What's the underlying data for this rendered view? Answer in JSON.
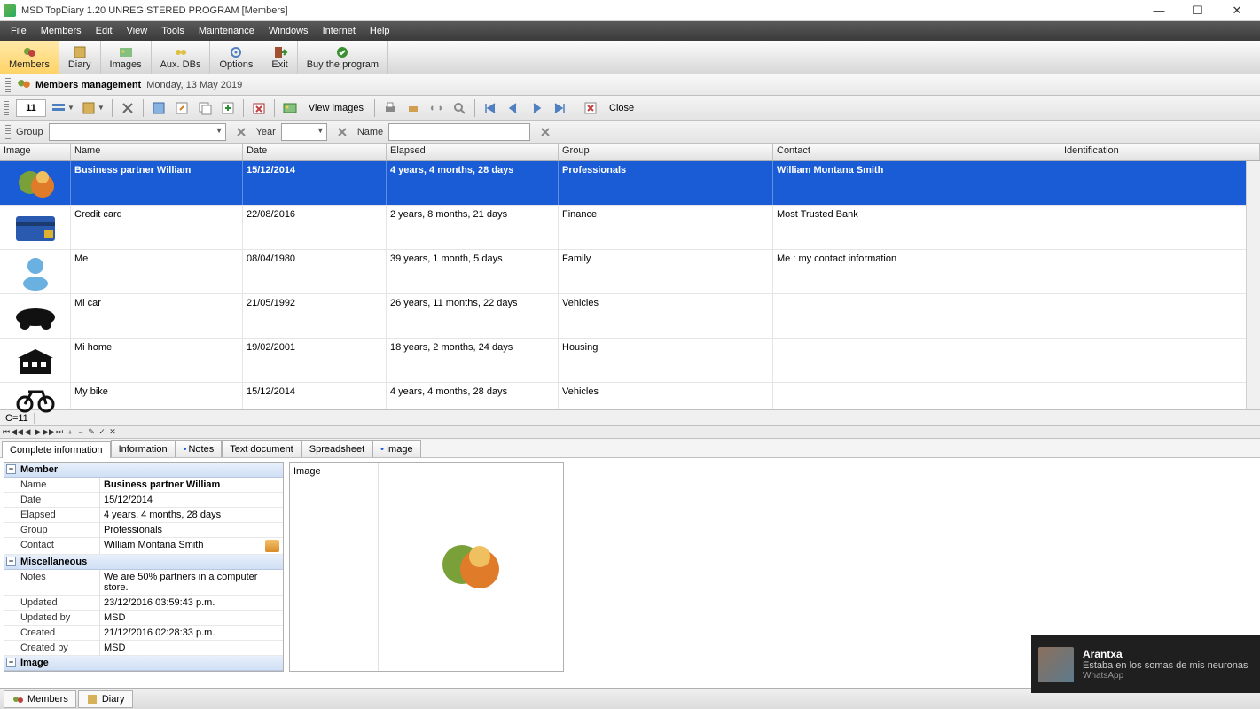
{
  "window": {
    "title": "MSD TopDiary 1.20 UNREGISTERED PROGRAM [Members]"
  },
  "menus": [
    "File",
    "Members",
    "Edit",
    "View",
    "Tools",
    "Maintenance",
    "Windows",
    "Internet",
    "Help"
  ],
  "main_toolbar": [
    {
      "id": "members",
      "label": "Members",
      "active": true
    },
    {
      "id": "diary",
      "label": "Diary",
      "active": false
    },
    {
      "id": "images",
      "label": "Images",
      "active": false
    },
    {
      "id": "auxdbs",
      "label": "Aux. DBs",
      "active": false
    },
    {
      "id": "options",
      "label": "Options",
      "active": false
    },
    {
      "id": "exit",
      "label": "Exit",
      "active": false
    },
    {
      "id": "buy",
      "label": "Buy the program",
      "active": false
    }
  ],
  "breadcrumb": {
    "title": "Members management",
    "date": "Monday, 13 May 2019"
  },
  "sub_toolbar": {
    "counter": "11",
    "view_images_label": "View images",
    "close_label": "Close"
  },
  "filter": {
    "group_label": "Group",
    "group_value": "",
    "year_label": "Year",
    "year_value": "",
    "name_label": "Name",
    "name_value": ""
  },
  "grid": {
    "headers": [
      "Image",
      "Name",
      "Date",
      "Elapsed",
      "Group",
      "Contact",
      "Identification"
    ],
    "rows": [
      {
        "icon": "people",
        "name": "Business partner William",
        "date": "15/12/2014",
        "elapsed": "4 years, 4 months, 28 days",
        "group": "Professionals",
        "contact": "William Montana Smith",
        "ident": "",
        "selected": true
      },
      {
        "icon": "card",
        "name": "Credit card",
        "date": "22/08/2016",
        "elapsed": "2 years, 8 months, 21 days",
        "group": "Finance",
        "contact": "Most Trusted Bank",
        "ident": "",
        "selected": false
      },
      {
        "icon": "person",
        "name": "Me",
        "date": "08/04/1980",
        "elapsed": "39 years, 1 month, 5 days",
        "group": "Family",
        "contact": "Me : my contact information",
        "ident": "",
        "selected": false
      },
      {
        "icon": "car",
        "name": "Mi car",
        "date": "21/05/1992",
        "elapsed": "26 years, 11 months, 22 days",
        "group": "Vehicles",
        "contact": "",
        "ident": "",
        "selected": false
      },
      {
        "icon": "house",
        "name": "Mi home",
        "date": "19/02/2001",
        "elapsed": "18 years, 2 months, 24 days",
        "group": "Housing",
        "contact": "",
        "ident": "",
        "selected": false
      },
      {
        "icon": "bike",
        "name": "My bike",
        "date": "15/12/2014",
        "elapsed": "4 years, 4 months, 28 days",
        "group": "Vehicles",
        "contact": "",
        "ident": "",
        "selected": false
      }
    ],
    "footer_count": "C=11"
  },
  "detail_tabs": [
    {
      "label": "Complete information",
      "active": true,
      "dot": false
    },
    {
      "label": "Information",
      "active": false,
      "dot": false
    },
    {
      "label": "Notes",
      "active": false,
      "dot": true
    },
    {
      "label": "Text document",
      "active": false,
      "dot": false
    },
    {
      "label": "Spreadsheet",
      "active": false,
      "dot": false
    },
    {
      "label": "Image",
      "active": false,
      "dot": true
    }
  ],
  "props": {
    "sections": [
      {
        "title": "Member",
        "rows": [
          {
            "k": "Name",
            "v": "Business partner William",
            "bold": true
          },
          {
            "k": "Date",
            "v": "15/12/2014"
          },
          {
            "k": "Elapsed",
            "v": "4 years, 4 months, 28 days"
          },
          {
            "k": "Group",
            "v": "Professionals"
          },
          {
            "k": "Contact",
            "v": "William Montana Smith",
            "badge": true
          }
        ]
      },
      {
        "title": "Miscellaneous",
        "rows": [
          {
            "k": "Notes",
            "v": "We are 50% partners in a computer store."
          },
          {
            "k": "Updated",
            "v": "23/12/2016 03:59:43 p.m."
          },
          {
            "k": "Updated by",
            "v": "MSD"
          },
          {
            "k": "Created",
            "v": "21/12/2016 02:28:33 p.m."
          },
          {
            "k": "Created by",
            "v": "MSD"
          }
        ]
      },
      {
        "title": "Image",
        "rows": []
      }
    ],
    "image_panel_label": "Image"
  },
  "bottom_tabs": [
    {
      "label": "Members",
      "icon": "people"
    },
    {
      "label": "Diary",
      "icon": "book"
    }
  ],
  "notification": {
    "title": "Arantxa",
    "message": "Estaba en los somas de mis neuronas",
    "source": "WhatsApp"
  }
}
